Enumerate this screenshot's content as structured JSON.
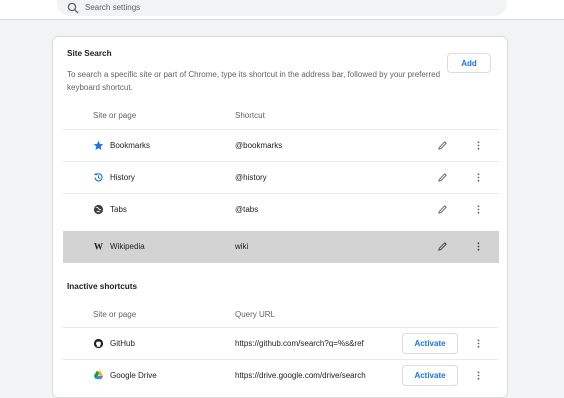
{
  "search": {
    "placeholder": "Search settings"
  },
  "site_search": {
    "title": "Site Search",
    "description": "To search a specific site or part of Chrome, type its shortcut in the address bar, followed by your preferred keyboard shortcut.",
    "add_label": "Add",
    "columns": {
      "site": "Site or page",
      "shortcut": "Shortcut"
    },
    "rows": [
      {
        "name": "Bookmarks",
        "shortcut": "@bookmarks",
        "icon": "star-icon"
      },
      {
        "name": "History",
        "shortcut": "@history",
        "icon": "history-icon"
      },
      {
        "name": "Tabs",
        "shortcut": "@tabs",
        "icon": "tabs-icon"
      },
      {
        "name": "Wikipedia",
        "shortcut": "wiki",
        "icon": "wikipedia-icon",
        "selected": true
      }
    ]
  },
  "inactive": {
    "title": "Inactive shortcuts",
    "columns": {
      "site": "Site or page",
      "query": "Query URL"
    },
    "rows": [
      {
        "name": "GitHub",
        "query": "https://github.com/search?q=%s&ref",
        "icon": "github-icon",
        "action": "Activate"
      },
      {
        "name": "Google Drive",
        "query": "https://drive.google.com/drive/search",
        "icon": "google-drive-icon",
        "action": "Activate"
      }
    ]
  },
  "colors": {
    "accent": "#1a73e8",
    "selected_row": "#d3d3d3"
  }
}
